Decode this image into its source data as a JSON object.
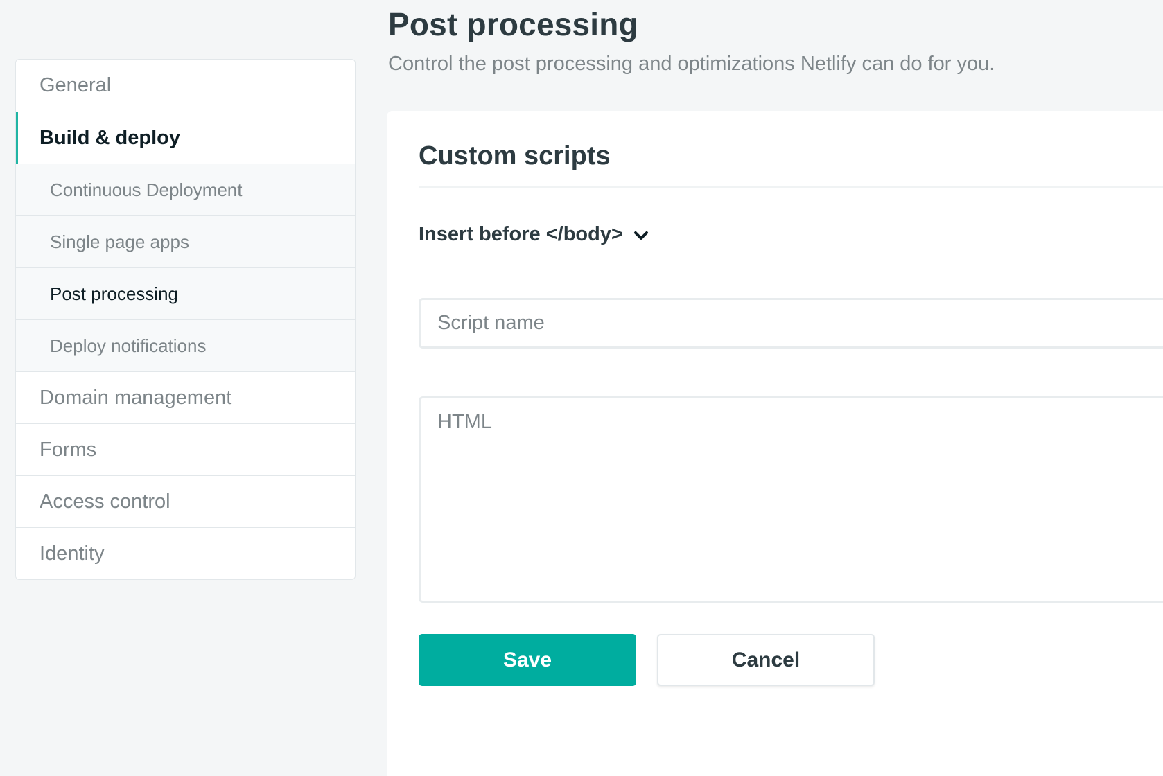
{
  "sidebar": {
    "items": [
      {
        "label": "General"
      },
      {
        "label": "Build & deploy"
      },
      {
        "label": "Continuous Deployment"
      },
      {
        "label": "Single page apps"
      },
      {
        "label": "Post processing"
      },
      {
        "label": "Deploy notifications"
      },
      {
        "label": "Domain management"
      },
      {
        "label": "Forms"
      },
      {
        "label": "Access control"
      },
      {
        "label": "Identity"
      }
    ],
    "active_item": "Build & deploy",
    "current_subitem": "Post processing",
    "accent_color": "#20b5a4"
  },
  "header": {
    "title": "Post processing",
    "subtitle": "Control the post processing and optimizations Netlify can do for you."
  },
  "card": {
    "title": "Custom scripts",
    "dropdown": {
      "selected": "Insert before </body>",
      "icon": "chevron-down-icon"
    },
    "script_name": {
      "value": "",
      "placeholder": "Script name"
    },
    "html": {
      "value": "",
      "placeholder": "HTML"
    },
    "save_label": "Save",
    "cancel_label": "Cancel",
    "save_color": "#00ad9f"
  }
}
